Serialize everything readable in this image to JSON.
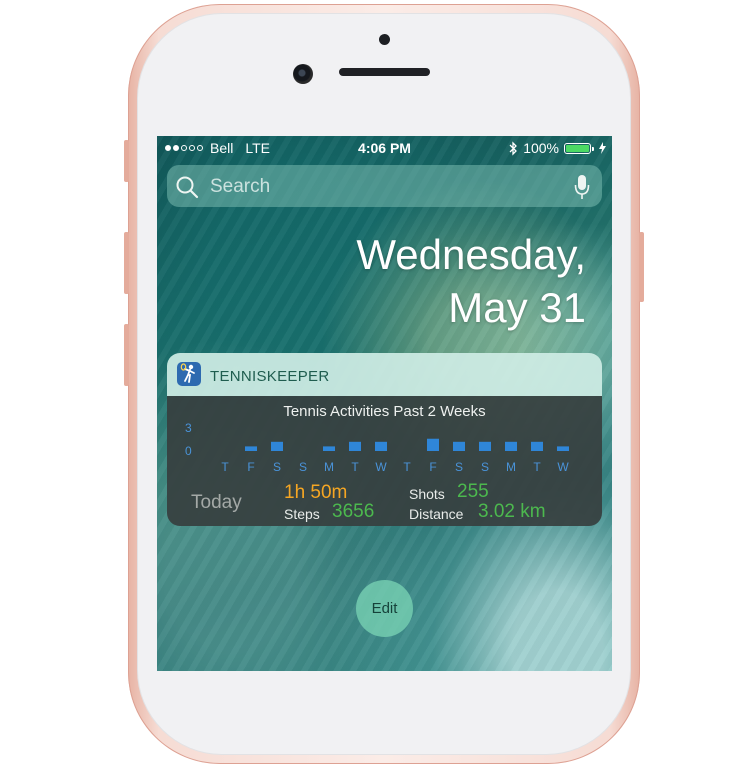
{
  "status_bar": {
    "signal_strength": 2,
    "signal_max": 5,
    "carrier": "Bell",
    "network": "LTE",
    "time": "4:06 PM",
    "battery": "100%",
    "battery_color": "#4cd964",
    "icons": [
      "bluetooth-icon",
      "battery-icon",
      "charging-icon"
    ]
  },
  "search": {
    "placeholder": "Search",
    "icons": [
      "search-icon",
      "mic-icon"
    ]
  },
  "date": {
    "weekday": "Wednesday,",
    "month_day": "May 31"
  },
  "widget": {
    "app_name": "TENNISKEEPER",
    "app_icon": "tennis-player-icon",
    "chart_data": {
      "type": "bar",
      "title": "Tennis Activities Past 2 Weeks",
      "categories": [
        "T",
        "F",
        "S",
        "S",
        "M",
        "T",
        "W",
        "T",
        "F",
        "S",
        "S",
        "M",
        "T",
        "W"
      ],
      "values": [
        0,
        0.6,
        1.2,
        0,
        0.6,
        1.2,
        1.2,
        0,
        1.6,
        1.2,
        1.2,
        1.2,
        1.2,
        0.6
      ],
      "y_ticks": [
        "3",
        "0"
      ],
      "ylim": [
        0,
        3
      ],
      "bar_color": "#2f86d8",
      "label_color": "#4a93d9"
    },
    "today": {
      "label": "Today",
      "time": "1h 50m",
      "time_color": "#f5a623",
      "steps_label": "Steps",
      "steps": "3656",
      "shots_label": "Shots",
      "shots": "255",
      "distance_label": "Distance",
      "distance": "3.02 km",
      "value_color": "#4cb94e"
    }
  },
  "edit_button": {
    "label": "Edit"
  }
}
